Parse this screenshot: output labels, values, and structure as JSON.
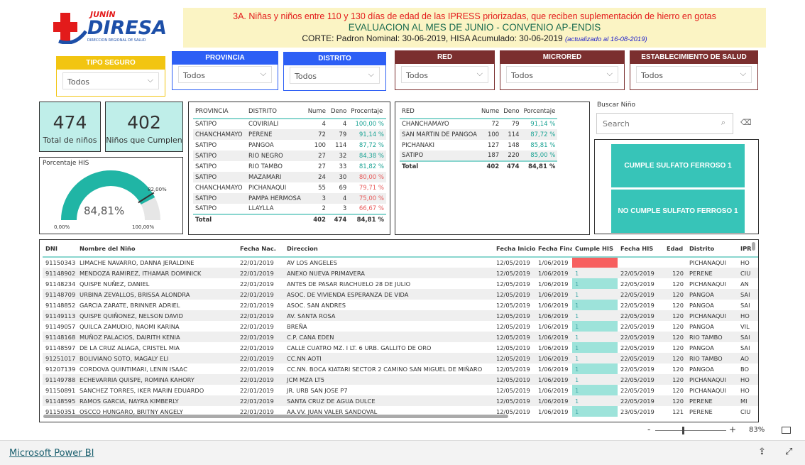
{
  "logo": {
    "top": "JUNÍN",
    "main": "DIRESA",
    "sub": "DIRECCION REGIONAL DE SALUD"
  },
  "header": {
    "line1": "3A. Niñas y niños entre 110 y 130 días de edad de las IPRESS priorizadas, que reciben suplementación de hierro  en gotas",
    "line2": "EVALUACION AL MES DE JUNIO - CONVENIO AP-ENDIS",
    "line3": "CORTE: Padron Nominal: 30-06-2019,  HISA Acumulado: 30-06-2019 ",
    "line3_note": "(actualizado al  16-08-2019)"
  },
  "colors": {
    "yellow": "#f2c511",
    "blue": "#2d5ff5",
    "maroon": "#7b2f2f",
    "teal": "#37c4b8",
    "red": "#f75f5f"
  },
  "slicers": [
    {
      "label": "TIPO SEGURO",
      "value": "Todos"
    },
    {
      "label": "PROVINCIA",
      "value": "Todos"
    },
    {
      "label": "DISTRITO",
      "value": "Todos"
    },
    {
      "label": "RED",
      "value": "Todos"
    },
    {
      "label": "MICRORED",
      "value": "Todos"
    },
    {
      "label": "ESTABLECIMIENTO DE SALUD",
      "value": "Todos"
    }
  ],
  "cards": [
    {
      "value": "474",
      "label": "Total de niños"
    },
    {
      "value": "402",
      "label": "Niños que Cumplen"
    }
  ],
  "gauge": {
    "title": "Porcentaje HIS",
    "value_label": "84,81%",
    "value": 84.81,
    "min_label": "0,00%",
    "max_label": "100,00%",
    "target_label": "82,00%",
    "target": 82
  },
  "distrito_table": {
    "headers": [
      "PROVINCIA",
      "DISTRITO",
      "Nume",
      "Deno",
      "Procentaje"
    ],
    "rows": [
      [
        "SATIPO",
        "COVIRIALI",
        "4",
        "4",
        "100,00 %"
      ],
      [
        "CHANCHAMAYO",
        "PERENE",
        "72",
        "79",
        "91,14 %"
      ],
      [
        "SATIPO",
        "PANGOA",
        "100",
        "114",
        "87,72 %"
      ],
      [
        "SATIPO",
        "RIO NEGRO",
        "27",
        "32",
        "84,38 %"
      ],
      [
        "SATIPO",
        "RIO TAMBO",
        "27",
        "33",
        "81,82 %"
      ],
      [
        "SATIPO",
        "MAZAMARI",
        "24",
        "30",
        "80,00 %"
      ],
      [
        "CHANCHAMAYO",
        "PICHANAQUI",
        "55",
        "69",
        "79,71 %"
      ],
      [
        "SATIPO",
        "PAMPA HERMOSA",
        "3",
        "4",
        "75,00 %"
      ],
      [
        "SATIPO",
        "LLAYLLA",
        "2",
        "3",
        "66,67 %"
      ]
    ],
    "total": [
      "Total",
      "",
      "402",
      "474",
      "84,81 %"
    ]
  },
  "red_table": {
    "headers": [
      "RED",
      "Nume",
      "Deno",
      "Porcentaje"
    ],
    "rows": [
      [
        "CHANCHAMAYO",
        "72",
        "79",
        "91,14 %"
      ],
      [
        "SAN MARTIN DE PANGOA",
        "100",
        "114",
        "87,72 %"
      ],
      [
        "PICHANAKI",
        "127",
        "148",
        "85,81 %"
      ],
      [
        "SATIPO",
        "187",
        "220",
        "85,00 %"
      ]
    ],
    "total": [
      "Total",
      "402",
      "474",
      "84,81 %"
    ]
  },
  "search": {
    "title": "Buscar Niño",
    "placeholder": "Search"
  },
  "buttons": {
    "cumple": "CUMPLE SULFATO FERROSO 1",
    "no_cumple": "NO CUMPLE SULFATO FERROSO 1"
  },
  "detail": {
    "headers": [
      "DNI",
      "Nombre del Niño",
      "Fecha Nac.",
      "Direccion",
      "Fecha Inicio",
      "Fecha Final",
      "Cumple HIS",
      "Fecha HIS",
      "Edad",
      "Distrito",
      "IPR"
    ],
    "rows": [
      [
        "91150343",
        "LIMACHE NAVARRO, DANNA JERALDINE",
        "22/01/2019",
        "AV LOS ANGELES",
        "12/05/2019",
        "1/06/2019",
        "",
        "",
        "",
        "PICHANAQUI",
        "HO"
      ],
      [
        "91148902",
        "MENDOZA RAMIREZ, ITHAMAR DOMINICK",
        "22/01/2019",
        "ANEXO NUEVA PRIMAVERA",
        "12/05/2019",
        "1/06/2019",
        "1",
        "22/05/2019",
        "120",
        "PERENE",
        "CIU"
      ],
      [
        "91148234",
        "QUISPE NUÑEZ, DANIEL",
        "22/01/2019",
        "ANTES DE PASAR RIACHUELO 28 DE JULIO",
        "12/05/2019",
        "1/06/2019",
        "1",
        "22/05/2019",
        "120",
        "PICHANAQUI",
        "AN"
      ],
      [
        "91148709",
        "URBINA ZEVALLOS, BRISSA ALONDRA",
        "22/01/2019",
        "ASOC. DE VIVIENDA ESPERANZA DE VIDA",
        "12/05/2019",
        "1/06/2019",
        "1",
        "22/05/2019",
        "120",
        "PANGOA",
        "SAI"
      ],
      [
        "91148852",
        "GARCIA ZARATE, BRINNER ADRIEL",
        "22/01/2019",
        "ASOC. SAN ANDRES",
        "12/05/2019",
        "1/06/2019",
        "1",
        "22/05/2019",
        "120",
        "PANGOA",
        "SAI"
      ],
      [
        "91149113",
        "QUISPE QUIÑONEZ, NELSON DAVID",
        "22/01/2019",
        "AV. SANTA ROSA",
        "12/05/2019",
        "1/06/2019",
        "1",
        "22/05/2019",
        "120",
        "PICHANAQUI",
        "HO"
      ],
      [
        "91149057",
        "QUILCA ZAMUDIO, NAOMI KARINA",
        "22/01/2019",
        "BREÑA",
        "12/05/2019",
        "1/06/2019",
        "1",
        "22/05/2019",
        "120",
        "PANGOA",
        "VIL"
      ],
      [
        "91148168",
        "MUÑOZ PALACIOS, DAIRITH KENIA",
        "22/01/2019",
        "C.P. CANA EDEN",
        "12/05/2019",
        "1/06/2019",
        "1",
        "22/05/2019",
        "120",
        "RIO TAMBO",
        "SAI"
      ],
      [
        "91148597",
        "DE LA CRUZ ALIAGA, CRISTEL MIA",
        "22/01/2019",
        "CALLE CUATRO MZ. I LT. 6 URB. GALLITO DE ORO",
        "12/05/2019",
        "1/06/2019",
        "1",
        "22/05/2019",
        "120",
        "PANGOA",
        "SAI"
      ],
      [
        "91251017",
        "BOLIVIANO SOTO, MAGALY ELI",
        "22/01/2019",
        "CC.NN AOTI",
        "12/05/2019",
        "1/06/2019",
        "1",
        "22/05/2019",
        "120",
        "RIO TAMBO",
        "AO"
      ],
      [
        "91207139",
        "CORDOVA QUINTIMARI, LENIN ISAAC",
        "22/01/2019",
        "CC.NN. BOCA KIATARI SECTOR 2 CAMINO SAN MIGUEL DE MIÑARO",
        "12/05/2019",
        "1/06/2019",
        "1",
        "22/05/2019",
        "120",
        "PANGOA",
        "BO"
      ],
      [
        "91149788",
        "ECHEVARRIA QUISPE, ROMINA KAHORY",
        "22/01/2019",
        "JCM MZA LT5",
        "12/05/2019",
        "1/06/2019",
        "1",
        "22/05/2019",
        "120",
        "PICHANAQUI",
        "HO"
      ],
      [
        "91150891",
        "SANCHEZ TORRES, IKER MARIN EDUARDO",
        "22/01/2019",
        "JR. URB SAN JOSE P7",
        "12/05/2019",
        "1/06/2019",
        "1",
        "22/05/2019",
        "120",
        "PICHANAQUI",
        "HO"
      ],
      [
        "91148595",
        "RAMOS GARCIA, NAYRA KIMBERLY",
        "22/01/2019",
        "SANTA CRUZ DE AGUA DULCE",
        "12/05/2019",
        "1/06/2019",
        "1",
        "22/05/2019",
        "120",
        "PERENE",
        "MI"
      ],
      [
        "91150351",
        "OSCCO HUNGARO, BRITNY ANGELY",
        "22/01/2019",
        "AA.VV. JUAN VALER SANDOVAL",
        "12/05/2019",
        "1/06/2019",
        "1",
        "23/05/2019",
        "121",
        "PERENE",
        "CIU"
      ]
    ]
  },
  "zoom": {
    "minus": "-",
    "plus": "+",
    "level": "83%",
    "value": 83
  },
  "footer": {
    "link": "Microsoft Power BI"
  }
}
